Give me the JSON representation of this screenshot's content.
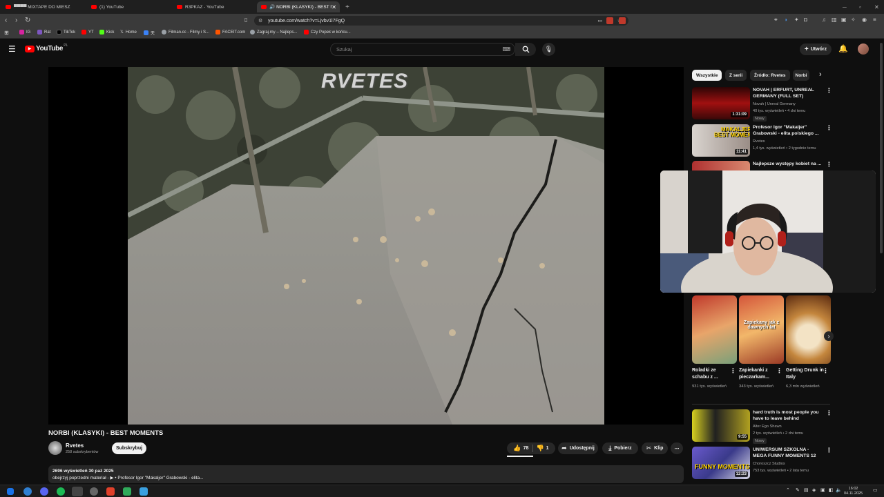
{
  "browser": {
    "tabs": [
      {
        "label": "▀▀▀▀ MIXTAPE DO MIESZ"
      },
      {
        "label": "(1) YouTube"
      },
      {
        "label": "R3PKAZ - YouTube"
      },
      {
        "label": "NORBI (KLASYKI) - BEST MO"
      }
    ],
    "new_tab": "+",
    "url": "youtube.com/watch?v=Ljvbv1l7FgQ",
    "bookmarks": [
      "IG",
      "Rat",
      "TikTok",
      "YT",
      "Kick",
      "Home",
      "天",
      "Filman.cc - Filmy i S...",
      "FACEIT.com",
      "Zagraj.my – Najleps...",
      "Czy Popek w końcu..."
    ],
    "bookmark_colors": [
      "#d6249f",
      "#7e57c2",
      "#111111",
      "#ff0000",
      "#53fc18",
      "#ffffff",
      "#3b82f6",
      "#9aa0a6",
      "#ff5500",
      "#9aa0a6",
      "#ff0000"
    ]
  },
  "youtube": {
    "logo": "YouTube",
    "region": "PL",
    "search_placeholder": "Szukaj",
    "create_label": "Utwórz",
    "accent": "#ff0000"
  },
  "video": {
    "watermark": "RVETES",
    "title": "NORBI (KLASYKI) - BEST MOMENTS",
    "channel": "Rvetes",
    "subscribers": "258 subskrybentów",
    "subscribe_label": "Subskrybuj",
    "likes": "78",
    "dislikes": "1",
    "share_label": "Udostępnij",
    "download_label": "Pobierz",
    "clip_label": "Klip",
    "views_date": "2696 wyświetleń  30 paź 2025",
    "description": "obejrzyj poprzedni materiał - ▶ • Profesor Igor \"Makaljer\" Grabowski - elita..."
  },
  "sidebar": {
    "chips": [
      "Wszystkie",
      "Z serii",
      "Źródło: Rvetes",
      "Norbi"
    ],
    "recs": [
      {
        "title": "NOVAH | ERFURT, UNREAL GERMANY (FULL SET)",
        "channel": "Novah | Unreal Germany",
        "meta": "40 tys. wyświetleń • 4 dni temu",
        "badge": "Nowy",
        "duration": "1:31:09"
      },
      {
        "title": "Profesor Igor \"Makaljer\" Grabowski - elita polskiego ...",
        "channel": "Rvetes",
        "meta": "1,4 tys. wyświetleń • 2 tygodnie temu",
        "badge": "",
        "duration": "11:41",
        "thumb_text": "MAKALJER\nBEST MOMENTS"
      },
      {
        "title": "Najlepsze występy kobiet na ...",
        "channel": "",
        "meta": "",
        "badge": "",
        "duration": ""
      }
    ],
    "shorts": [
      {
        "title": "Roladki ze schabu z ...",
        "views": "931 tys. wyświetleń"
      },
      {
        "title": "Zapiekanki z pieczarkam...",
        "views": "343 tys. wyświetleń",
        "overlay": "Zapiekany jak z dawnych lat"
      },
      {
        "title": "Getting Drunk in Italy",
        "views": "6,3 mln wyświetleń"
      }
    ],
    "recs2": [
      {
        "title": "hard truth is most people you have to leave behind",
        "channel": "Alter Ego Shawn",
        "meta": "2 tys. wyświetleń • 2 dni temu",
        "badge": "Nowy",
        "duration": "9:55"
      },
      {
        "title": "UNIWERSUM SZKOLNA - MEGA FUNNY MOMENTS 12",
        "channel": "Choroszcz Studios",
        "meta": "753 tys. wyświetleń • 2 lata temu",
        "badge": "",
        "duration": "12:23",
        "thumb_text": "FUNNY MOMENTS"
      }
    ]
  },
  "taskbar": {
    "time": "16:02",
    "date": "04.11.2025"
  }
}
